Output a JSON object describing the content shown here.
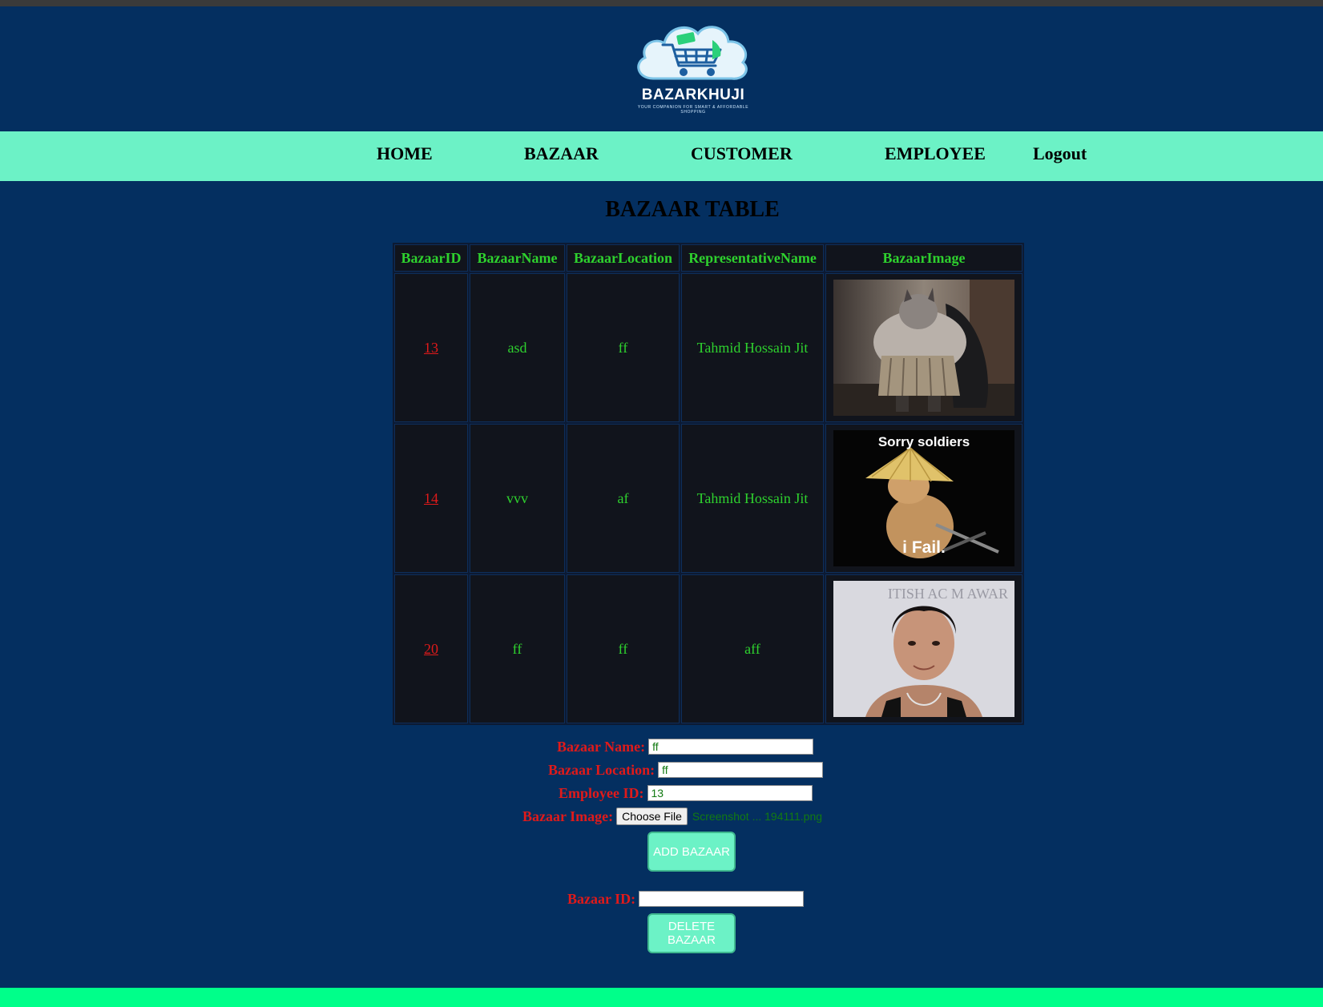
{
  "brand": {
    "name": "BAZARKHUJI",
    "tagline": "YOUR COMPANION FOR SMART & AFFORDABLE SHOPPING"
  },
  "nav": {
    "home": "HOME",
    "bazaar": "BAZAAR",
    "customer": "CUSTOMER",
    "employee": "EMPLOYEE",
    "logout": "Logout"
  },
  "page_title": "BAZAAR TABLE",
  "table": {
    "headers": [
      "BazaarID",
      "BazaarName",
      "BazaarLocation",
      "RepresentativeName",
      "BazaarImage"
    ],
    "rows": [
      {
        "id": "13",
        "name": "asd",
        "location": "ff",
        "representative": "Tahmid Hossain Jit",
        "image": "rotund-caped-figure-photo"
      },
      {
        "id": "14",
        "name": "vvv",
        "location": "af",
        "representative": "Tahmid Hossain Jit",
        "image": "sorry-soldiers-meme",
        "image_text_top": "Sorry soldiers",
        "image_text_bottom": "i Fail."
      },
      {
        "id": "20",
        "name": "ff",
        "location": "ff",
        "representative": "aff",
        "image": "man-portrait-photo",
        "image_text": "ITISH AC M AWAR"
      }
    ]
  },
  "form": {
    "name_label": "Bazaar Name:",
    "name_value": "ff",
    "location_label": "Bazaar Location:",
    "location_value": "ff",
    "employee_label": "Employee ID:",
    "employee_value": "13",
    "image_label": "Bazaar Image:",
    "choose_file_label": "Choose File",
    "file_name": "Screenshot ... 194111.png",
    "add_label": "ADD BAZAAR"
  },
  "delete_form": {
    "id_label": "Bazaar ID:",
    "id_value": "",
    "delete_label": "DELETE BAZAAR"
  },
  "colors": {
    "background": "#042f60",
    "nav": "#6cf2c6",
    "footer": "#00ff8a",
    "table_text": "#2ed12e",
    "label_red": "#e01a1a"
  }
}
